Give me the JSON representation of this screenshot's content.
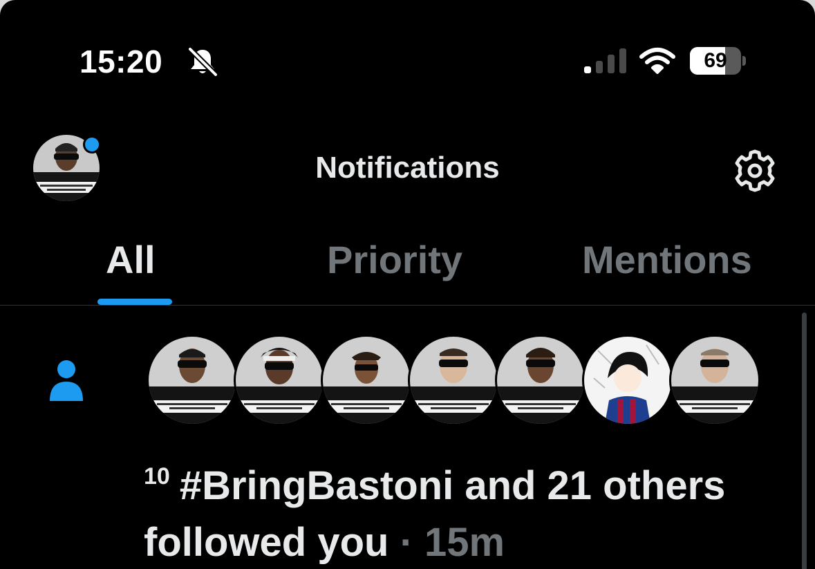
{
  "status_bar": {
    "time": "15:20",
    "battery_percent": 69,
    "battery_label": "69",
    "signal_bars_active": 1,
    "signal_bars_total": 4,
    "icons": [
      "bell-slash-icon",
      "cellular-signal-icon",
      "wifi-icon",
      "battery-icon"
    ]
  },
  "header": {
    "title": "Notifications",
    "settings_icon": "gear-icon",
    "has_unread_dot": true
  },
  "tabs": [
    {
      "label": "All",
      "active": true
    },
    {
      "label": "Priority",
      "active": false
    },
    {
      "label": "Mentions",
      "active": false
    }
  ],
  "notification": {
    "icon": "person-icon",
    "count": "10",
    "text": "#BringBastoni and 21 others followed you",
    "separator": "·",
    "time": "15m",
    "avatar_count": 7
  },
  "colors": {
    "accent": "#1d9bf0",
    "background": "#000000",
    "primary_text": "#e7e9ea",
    "secondary_text": "#71767b",
    "divider": "#2f3336"
  }
}
